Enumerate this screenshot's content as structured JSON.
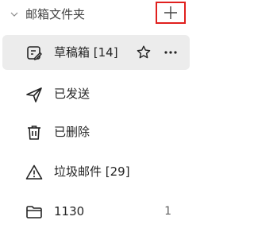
{
  "section": {
    "title": "邮箱文件夹",
    "collapse_icon": "chevron-down-icon",
    "add_icon": "plus-icon"
  },
  "folders": [
    {
      "label": "草稿箱 [14]",
      "icon": "drafts-edit-icon",
      "selected": true
    },
    {
      "label": "已发送",
      "icon": "send-icon"
    },
    {
      "label": "已删除",
      "icon": "trash-icon"
    },
    {
      "label": "垃圾邮件 [29]",
      "icon": "warning-icon"
    },
    {
      "label": "1130",
      "icon": "folder-icon",
      "count": "1"
    }
  ],
  "colors": {
    "selected_background": "#ececec",
    "highlight_border": "#e0201e",
    "text": "#242424",
    "secondary_text": "#616161"
  }
}
